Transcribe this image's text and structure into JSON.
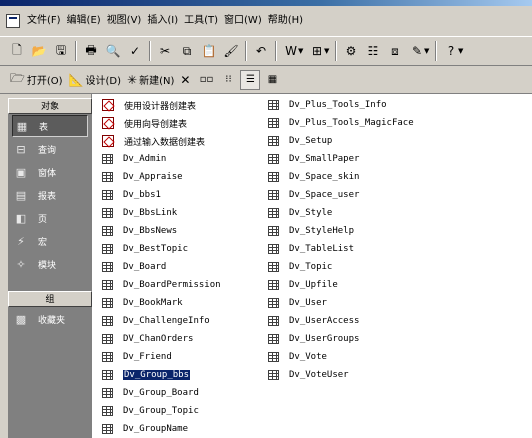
{
  "menubar": {
    "items": [
      "文件(F)",
      "编辑(E)",
      "视图(V)",
      "插入(I)",
      "工具(T)",
      "窗口(W)",
      "帮助(H)"
    ]
  },
  "toolbar": {
    "buttons": [
      "new-icon",
      "open-icon",
      "save-icon",
      "print-icon",
      "print-preview-icon",
      "spelling-icon",
      "cut-icon",
      "copy-icon",
      "paste-icon",
      "format-painter-icon",
      "undo-icon",
      "office-links-icon",
      "analyze-icon",
      "code-icon",
      "properties-icon",
      "relationships-icon",
      "new-object-icon",
      "help-icon"
    ]
  },
  "dbbar": {
    "open_label": "打开(O)",
    "design_label": "设计(D)",
    "new_label": "新建(N)"
  },
  "nav": {
    "objects_header": "对象",
    "items": [
      {
        "label": "表",
        "icon": "table-icon"
      },
      {
        "label": "查询",
        "icon": "query-icon"
      },
      {
        "label": "窗体",
        "icon": "form-icon"
      },
      {
        "label": "报表",
        "icon": "report-icon"
      },
      {
        "label": "页",
        "icon": "page-icon"
      },
      {
        "label": "宏",
        "icon": "macro-icon"
      },
      {
        "label": "模块",
        "icon": "module-icon"
      }
    ],
    "groups_header": "组",
    "group_items": [
      {
        "label": "收藏夹",
        "icon": "favorites-icon"
      }
    ]
  },
  "objects": {
    "col1": [
      {
        "label": "使用设计器创建表",
        "type": "wizard"
      },
      {
        "label": "使用向导创建表",
        "type": "wizard"
      },
      {
        "label": "通过输入数据创建表",
        "type": "wizard"
      },
      {
        "label": "Dv_Admin",
        "type": "table"
      },
      {
        "label": "Dv_Appraise",
        "type": "table"
      },
      {
        "label": "Dv_bbs1",
        "type": "table"
      },
      {
        "label": "Dv_BbsLink",
        "type": "table"
      },
      {
        "label": "Dv_BbsNews",
        "type": "table"
      },
      {
        "label": "Dv_BestTopic",
        "type": "table"
      },
      {
        "label": "Dv_Board",
        "type": "table"
      },
      {
        "label": "Dv_BoardPermission",
        "type": "table"
      },
      {
        "label": "Dv_BookMark",
        "type": "table"
      },
      {
        "label": "Dv_ChallengeInfo",
        "type": "table"
      },
      {
        "label": "DV_ChanOrders",
        "type": "table"
      },
      {
        "label": "Dv_Friend",
        "type": "table"
      },
      {
        "label": "Dv_Group_bbs",
        "type": "table",
        "selected": true
      },
      {
        "label": "Dv_Group_Board",
        "type": "table"
      },
      {
        "label": "Dv_Group_Topic",
        "type": "table"
      },
      {
        "label": "Dv_GroupName",
        "type": "table"
      }
    ],
    "col2": [
      {
        "label": "Dv_Plus_Tools_Info",
        "type": "table"
      },
      {
        "label": "Dv_Plus_Tools_MagicFace",
        "type": "table"
      },
      {
        "label": "Dv_Setup",
        "type": "table"
      },
      {
        "label": "Dv_SmallPaper",
        "type": "table"
      },
      {
        "label": "Dv_Space_skin",
        "type": "table"
      },
      {
        "label": "Dv_Space_user",
        "type": "table"
      },
      {
        "label": "Dv_Style",
        "type": "table"
      },
      {
        "label": "Dv_StyleHelp",
        "type": "table"
      },
      {
        "label": "Dv_TableList",
        "type": "table"
      },
      {
        "label": "Dv_Topic",
        "type": "table"
      },
      {
        "label": "Dv_Upfile",
        "type": "table"
      },
      {
        "label": "Dv_User",
        "type": "table"
      },
      {
        "label": "Dv_UserAccess",
        "type": "table"
      },
      {
        "label": "Dv_UserGroups",
        "type": "table"
      },
      {
        "label": "Dv_Vote",
        "type": "table"
      },
      {
        "label": "Dv_VoteUser",
        "type": "table"
      }
    ]
  },
  "colors": {
    "face": "#d4d0c8",
    "nav_bg": "#808080",
    "selection": "#0a246a"
  }
}
